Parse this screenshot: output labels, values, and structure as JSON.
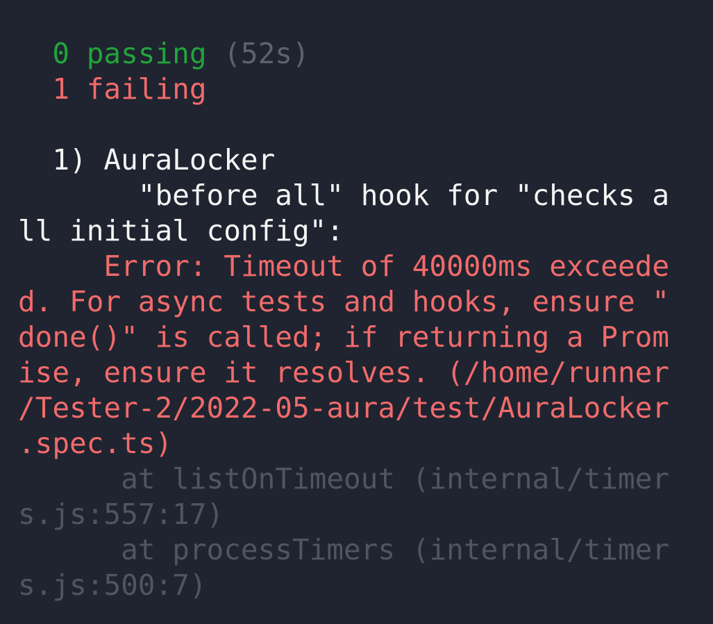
{
  "summary": {
    "passing_count": "0 passing",
    "passing_time": "(52s)",
    "failing_count": "1 failing"
  },
  "failure": {
    "title": "1) AuraLocker",
    "hook_line_1": "\"before all\" hook for \"checks a",
    "hook_line_2": "ll initial config\":",
    "error_lines": [
      "Error: Timeout of 40000ms exceede",
      "d. For async tests and hooks, ensure \"",
      "done()\" is called; if returning a Prom",
      "ise, ensure it resolves. (/home/runner",
      "/Tester-2/2022-05-aura/test/AuraLocker",
      ".spec.ts)"
    ],
    "stack_lines": [
      "at listOnTimeout (internal/timer",
      "s.js:557:17)",
      "at processTimers (internal/timer",
      "s.js:500:7)"
    ]
  },
  "colors": {
    "background": "#1f2430",
    "passing": "#22a43a",
    "failing": "#f16b6b",
    "text": "#f5f5f5",
    "muted": "#5c6370",
    "stack": "#4f5563"
  }
}
